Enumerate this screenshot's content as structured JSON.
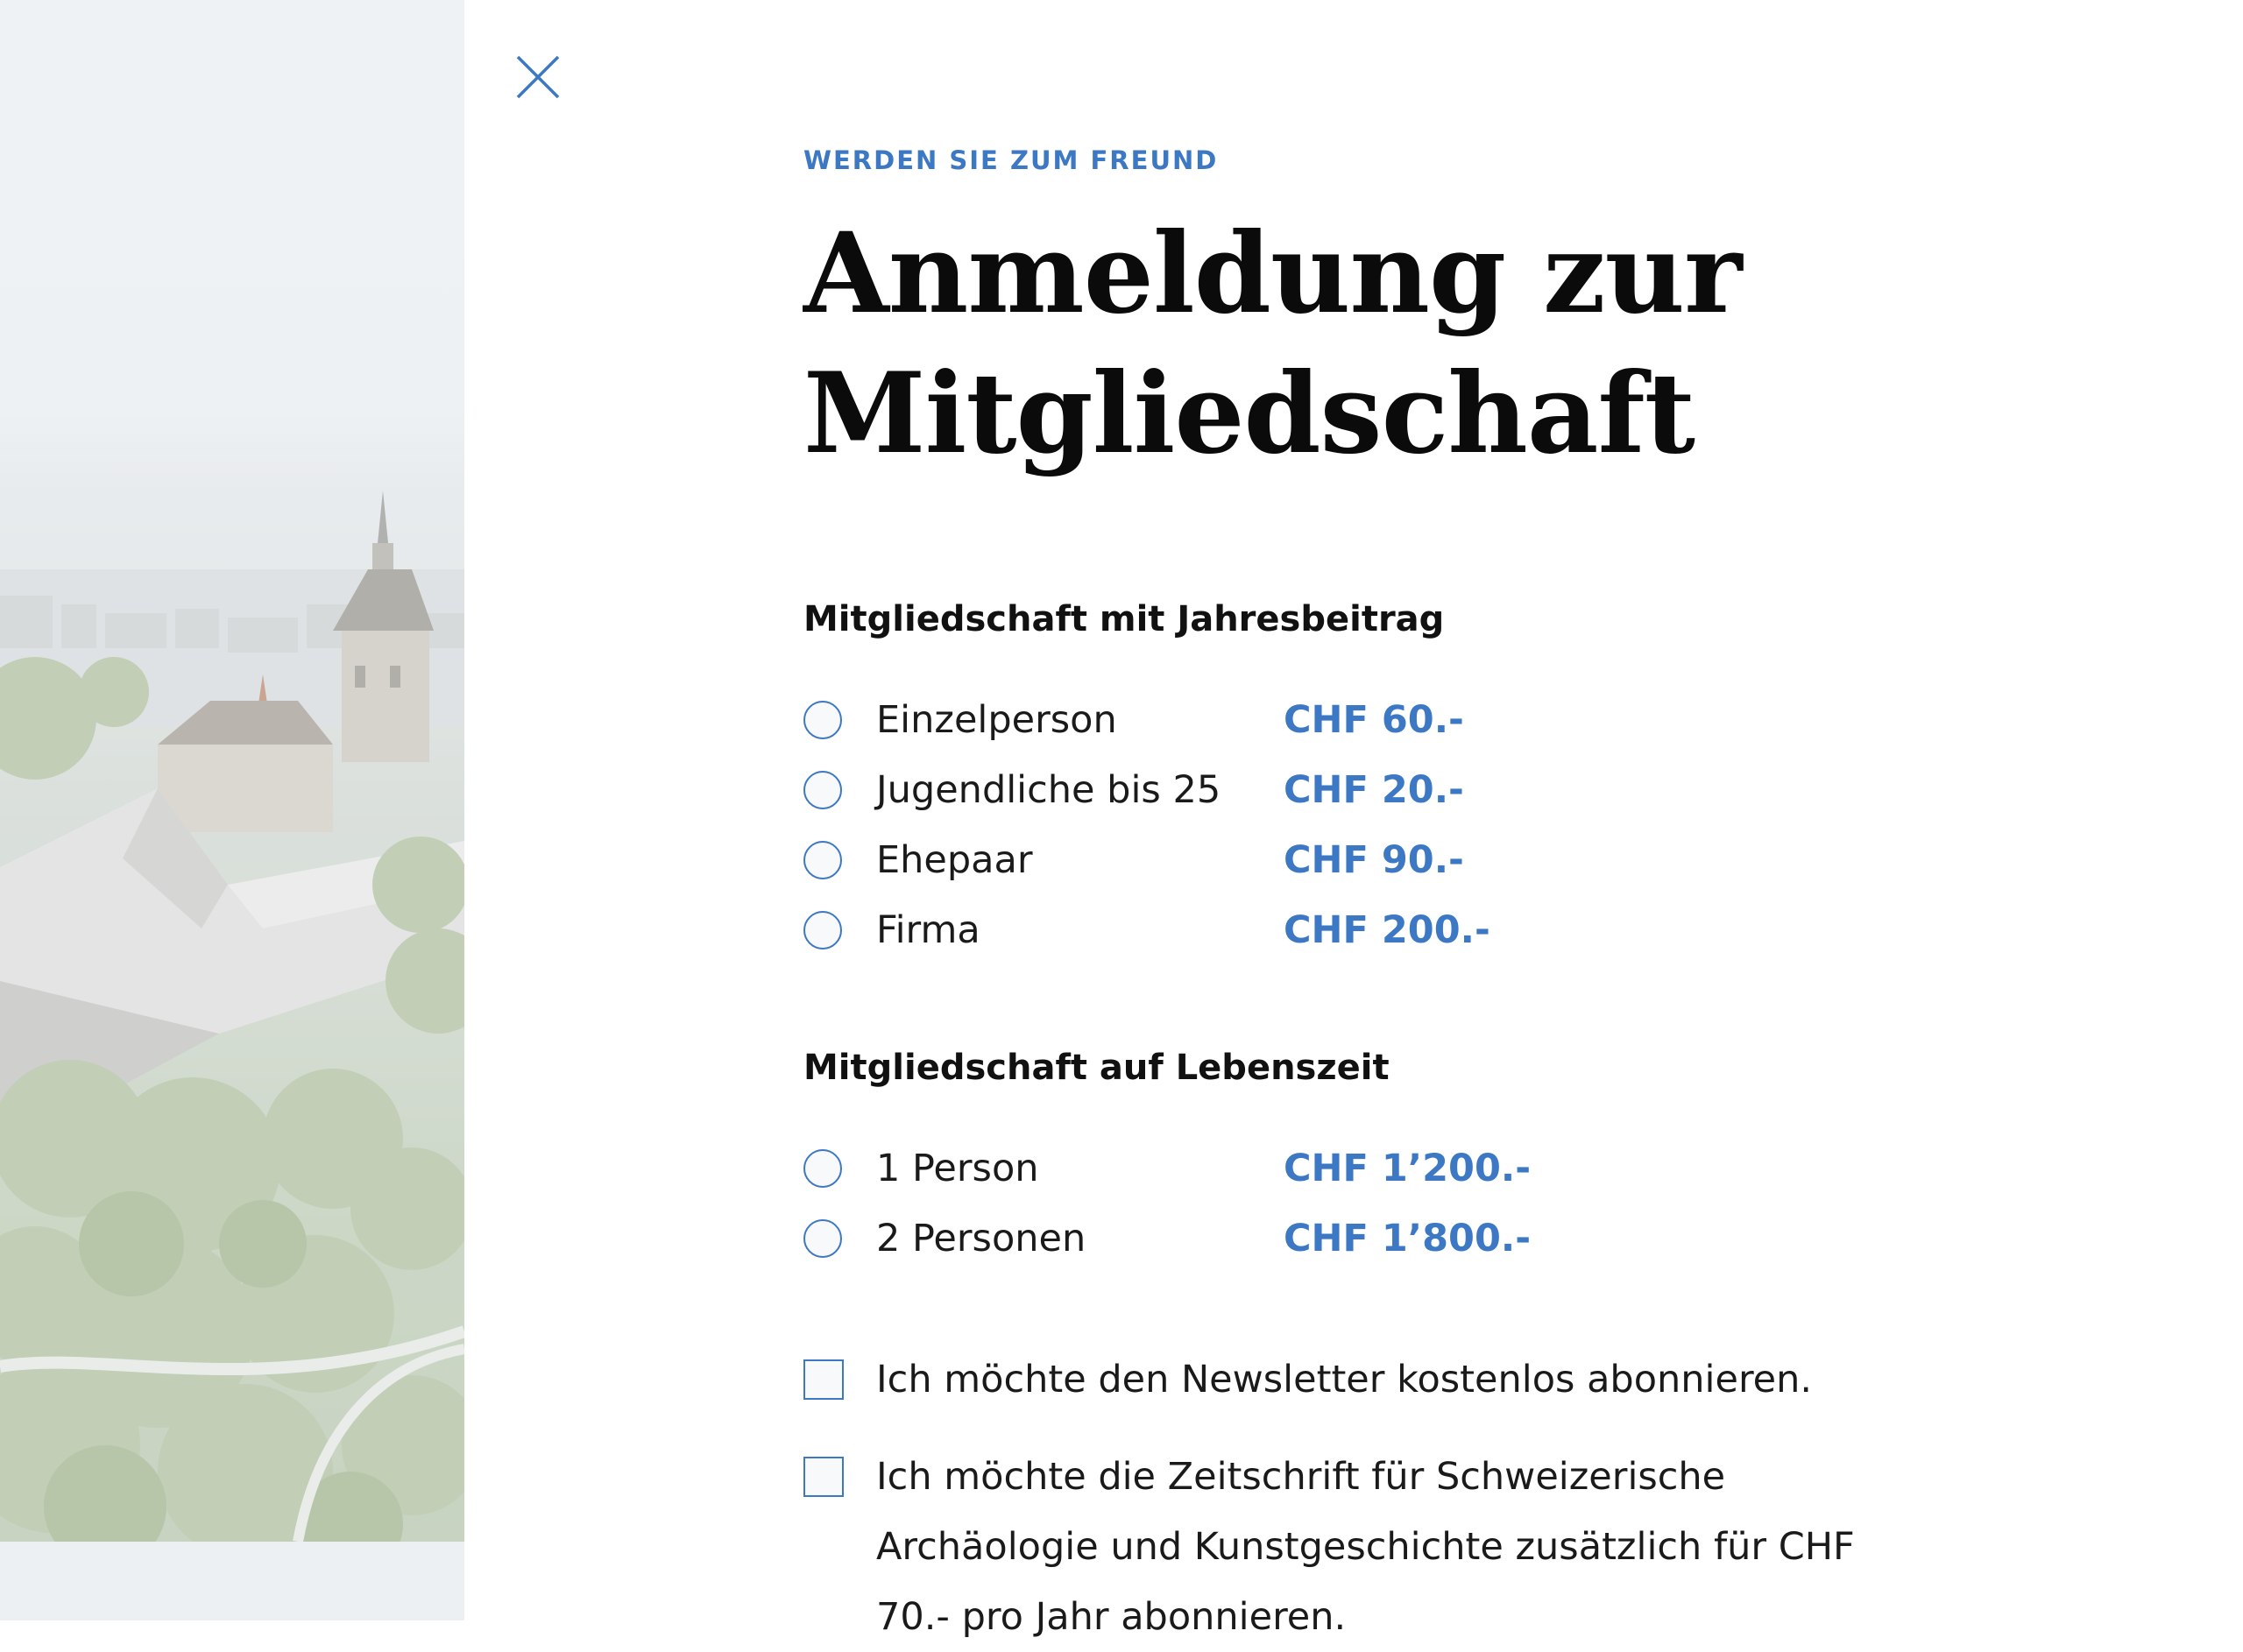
{
  "colors": {
    "accent": "#3c78c3",
    "text": "#111111",
    "panel": "#ecf0f3"
  },
  "close": {
    "icon": "close-icon"
  },
  "header": {
    "eyebrow": "WERDEN SIE ZUM FREUND",
    "title_line1": "Anmeldung zur",
    "title_line2": "Mitgliedschaft"
  },
  "annual": {
    "heading": "Mitgliedschaft mit Jahresbeitrag",
    "options": [
      {
        "label": "Einzelperson",
        "price": "CHF 60.-"
      },
      {
        "label": "Jugendliche bis 25",
        "price": "CHF 20.-"
      },
      {
        "label": "Ehepaar",
        "price": "CHF 90.-"
      },
      {
        "label": "Firma",
        "price": "CHF 200.-"
      }
    ]
  },
  "lifetime": {
    "heading": "Mitgliedschaft auf Lebenszeit",
    "options": [
      {
        "label": "1 Person",
        "price": "CHF 1’200.-"
      },
      {
        "label": "2 Personen",
        "price": "CHF 1’800.-"
      }
    ]
  },
  "checkboxes": [
    {
      "label": "Ich möchte den Newsletter kostenlos abonnieren."
    },
    {
      "label": "Ich möchte die Zeitschrift für Schweizerische Archäologie und Kunstgeschichte zusätzlich für CHF 70.- pro Jahr abonnieren."
    }
  ]
}
